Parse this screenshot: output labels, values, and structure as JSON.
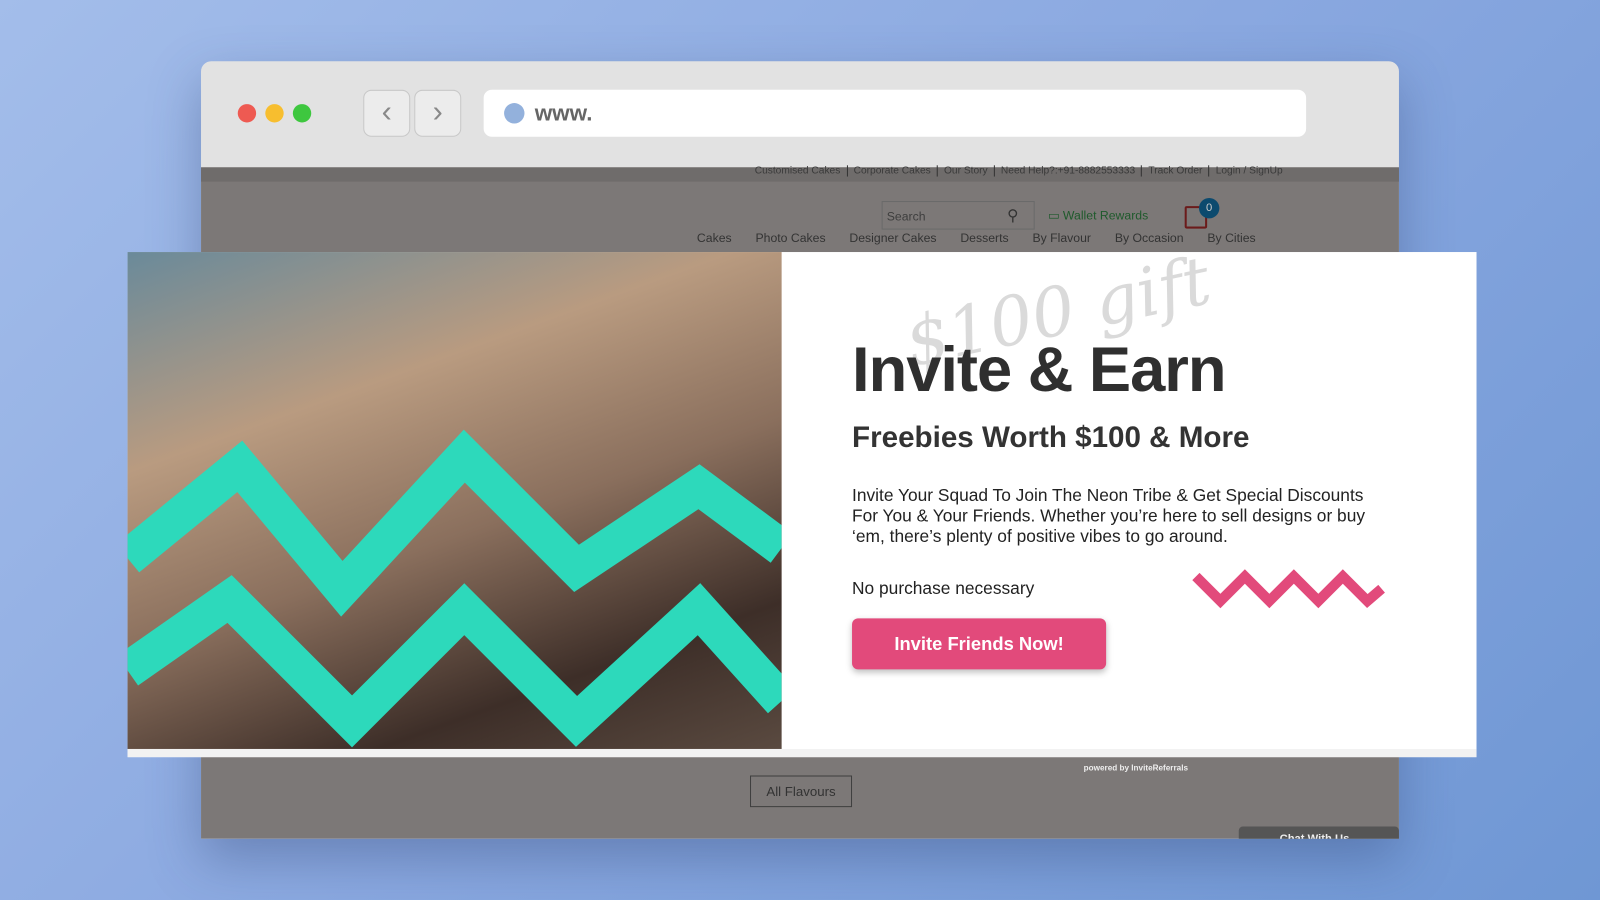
{
  "browser": {
    "url": "www.",
    "traffic_lights": [
      "#ee5a52",
      "#f7be2f",
      "#3ec73f"
    ]
  },
  "site": {
    "top_links": [
      "Customised Cakes",
      "Corporate Cakes",
      "Our Story",
      "Need Help?:+91-8882553333",
      "Track Order",
      "Login / SignUp"
    ],
    "search_placeholder": "Search",
    "wallet": "Wallet Rewards",
    "cart_count": "0",
    "menu": [
      "Cakes",
      "Photo Cakes",
      "Designer Cakes",
      "Desserts",
      "By Flavour",
      "By Occasion",
      "By Cities"
    ],
    "all_flavours": "All Flavours",
    "chat": "Chat With Us",
    "powered": "powered by InviteReferrals"
  },
  "modal": {
    "gift_script": "$100 gift",
    "title": "Invite & Earn",
    "subtitle": "Freebies Worth $100 & More",
    "description": "Invite Your Squad To Join The Neon Tribe & Get Special Discounts For You & Your Friends. Whether you’re here to sell designs or buy ‘em, there’s plenty of positive vibes to go around.",
    "note": "No purchase necessary",
    "cta": "Invite Friends Now!",
    "accent": "#e24a7b",
    "teal": "#2dd9bb"
  }
}
